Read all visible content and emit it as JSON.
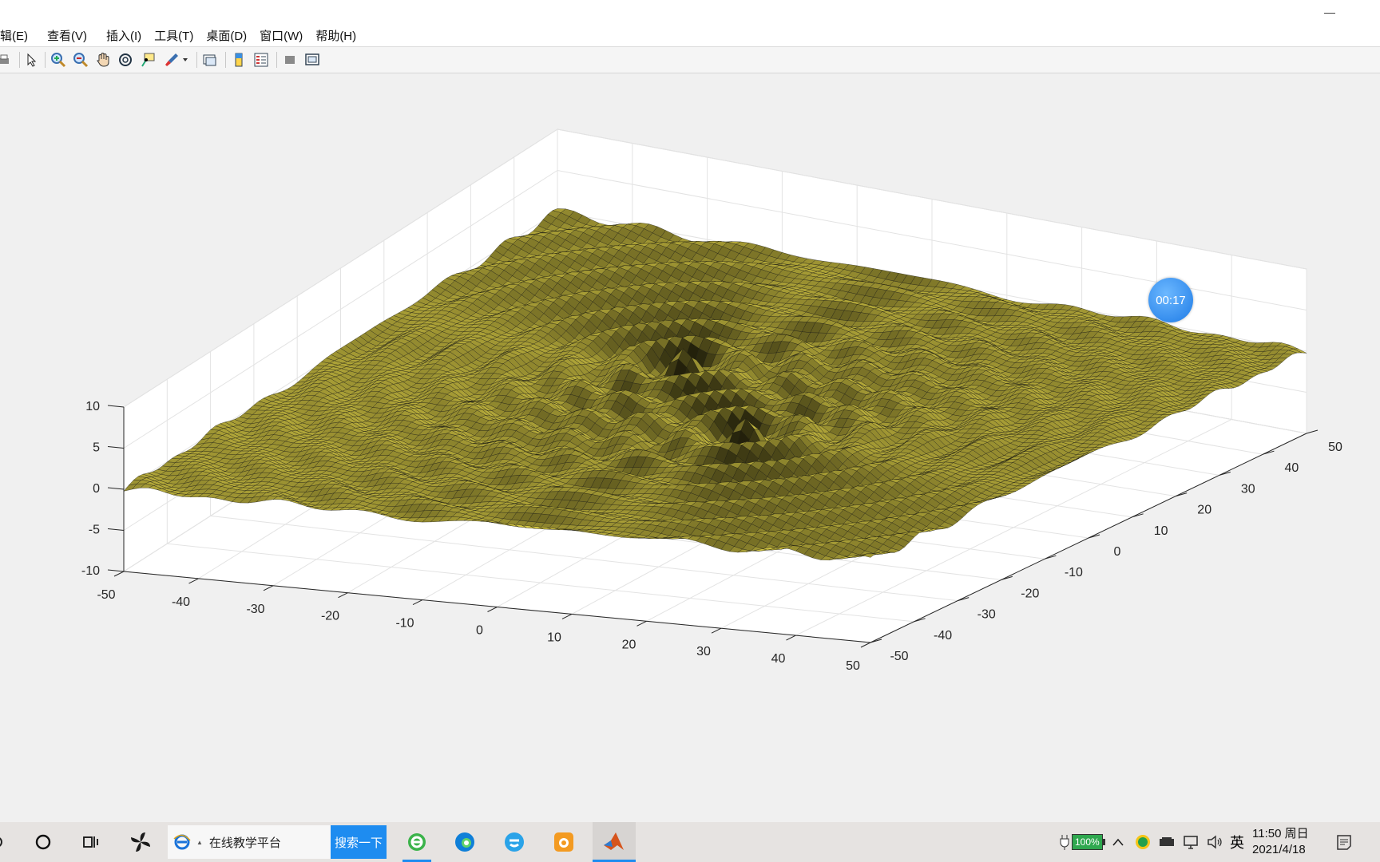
{
  "window": {
    "minimize_glyph": "—"
  },
  "menu": [
    "辑(E)",
    "查看(V)",
    "插入(I)",
    "工具(T)",
    "桌面(D)",
    "窗口(W)",
    "帮助(H)"
  ],
  "toolbar": {
    "icons": [
      "print-icon",
      "pointer-icon",
      "zoom-in-icon",
      "zoom-out-icon",
      "pan-hand-icon",
      "rotate-3d-icon",
      "data-cursor-icon",
      "brush-icon",
      "link-plot-icon",
      "colorbar-icon",
      "legend-icon",
      "hide-plot-tools-icon",
      "show-plot-tools-icon"
    ]
  },
  "timer": {
    "label": "00:17"
  },
  "chart_data": {
    "type": "surface",
    "description_function": "two-source ripple interference surface, mesh grid colored yellow",
    "x": {
      "ticks": [
        -50,
        -40,
        -30,
        -20,
        -10,
        0,
        10,
        20,
        30,
        40,
        50
      ],
      "lim": [
        -50,
        50
      ]
    },
    "y": {
      "ticks": [
        -50,
        -40,
        -30,
        -20,
        -10,
        0,
        10,
        20,
        30,
        40,
        50
      ],
      "lim": [
        -50,
        50
      ]
    },
    "z": {
      "ticks": [
        -10,
        -5,
        0,
        5,
        10
      ],
      "lim": [
        -10,
        10
      ]
    },
    "peaks": [
      {
        "x": -10,
        "y": 10,
        "z": 2
      },
      {
        "x": 10,
        "y": -10,
        "z": 2
      }
    ],
    "surface_color": "#e6d84a",
    "edge_color": "#000000",
    "grid": true
  },
  "taskbar": {
    "search_text": "在线教学平台",
    "search_button": "搜索一下",
    "battery": "100%",
    "ime": "英",
    "time": "11:50 周日",
    "date": "2021/4/18"
  }
}
